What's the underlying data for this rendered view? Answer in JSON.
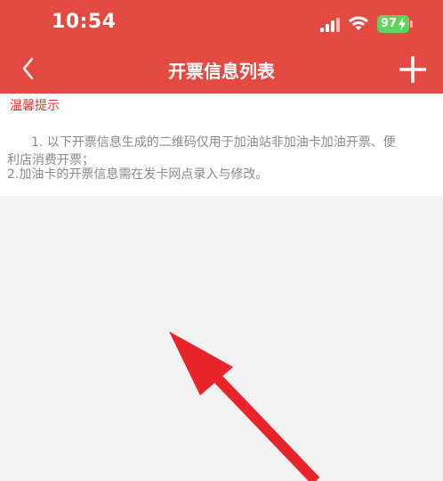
{
  "status_bar": {
    "time": "10:54",
    "battery": "97",
    "icons": [
      "signal-icon",
      "wifi-icon",
      "battery-icon"
    ]
  },
  "nav": {
    "back_icon": "chevron-left-icon",
    "title": "开票信息列表",
    "add_icon": "plus-icon"
  },
  "tips": {
    "title": "温馨提示",
    "line1": "1. 以下开票信息生成的二维码仅用于加油站非加油卡加油开票、便",
    "line2": "利店消费开票；",
    "line3": "2.加油卡的开票信息需在发卡网点录入与修改。"
  },
  "colors": {
    "header": "#e24a42",
    "tip_title": "#e0322a",
    "tip_text": "#8a8a8a",
    "background": "#f2f2f2",
    "arrow": "#e8242a",
    "battery": "#5fd35b"
  }
}
